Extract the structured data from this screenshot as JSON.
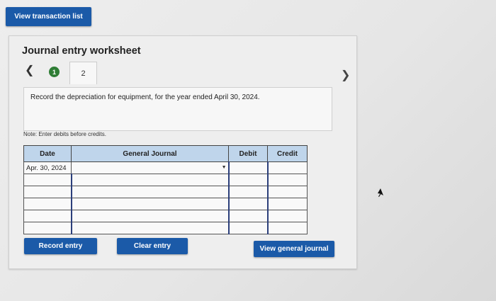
{
  "top": {
    "view_transaction_list": "View transaction list"
  },
  "worksheet": {
    "title": "Journal entry worksheet",
    "steps": [
      "1",
      "2"
    ],
    "instruction": "Record the depreciation for equipment, for the year ended April 30, 2024.",
    "note": "Note: Enter debits before credits."
  },
  "table": {
    "headers": {
      "date": "Date",
      "general_journal": "General Journal",
      "debit": "Debit",
      "credit": "Credit"
    },
    "rows": [
      {
        "date": "Apr. 30, 2024",
        "account": "",
        "debit": "",
        "credit": ""
      },
      {
        "date": "",
        "account": "",
        "debit": "",
        "credit": ""
      },
      {
        "date": "",
        "account": "",
        "debit": "",
        "credit": ""
      },
      {
        "date": "",
        "account": "",
        "debit": "",
        "credit": ""
      },
      {
        "date": "",
        "account": "",
        "debit": "",
        "credit": ""
      },
      {
        "date": "",
        "account": "",
        "debit": "",
        "credit": ""
      }
    ]
  },
  "buttons": {
    "record_entry": "Record entry",
    "clear_entry": "Clear entry",
    "view_general_journal": "View general journal"
  },
  "icons": {
    "prev": "chevron-left-icon",
    "next": "chevron-right-icon",
    "dropdown": "caret-down-icon",
    "cursor": "mouse-pointer-icon"
  },
  "colors": {
    "button": "#1b5aa8",
    "header": "#bfd5eb",
    "step_complete": "#2f7d35"
  }
}
